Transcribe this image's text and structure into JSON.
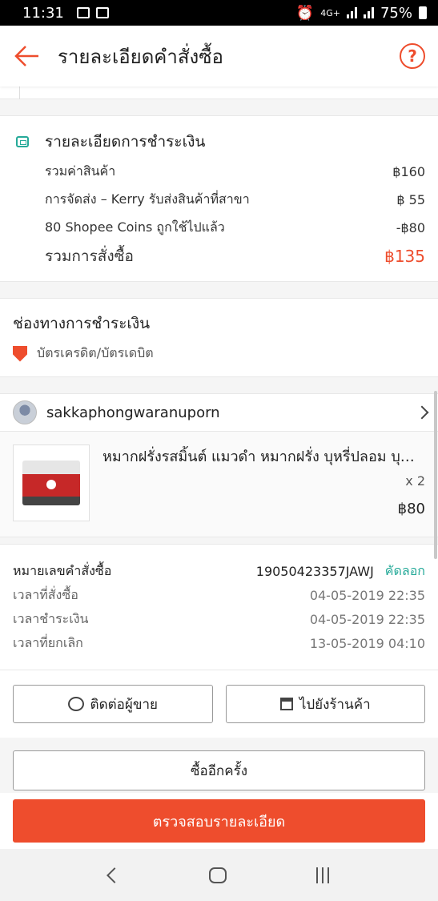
{
  "status_bar": {
    "time": "11:31",
    "network": "4G+",
    "battery": "75%"
  },
  "header": {
    "title": "รายละเอียดคำสั่งซื้อ",
    "help_label": "?"
  },
  "payment_details": {
    "title": "รายละเอียดการชำระเงิน",
    "rows": [
      {
        "label": "รวมค่าสินค้า",
        "value": "฿160"
      },
      {
        "label": "การจัดส่ง – Kerry รับส่งสินค้าที่สาขา",
        "value": "฿ 55"
      },
      {
        "label": "80 Shopee Coins ถูกใช้ไปแล้ว",
        "value": "-฿80"
      }
    ],
    "total_label": "รวมการสั่งซื้อ",
    "total_value": "฿135",
    "accent_color": "#ee4d2d"
  },
  "payment_method": {
    "title": "ช่องทางการชำระเงิน",
    "method": "บัตรเครดิต/บัตรเดบิต"
  },
  "seller": {
    "name": "sakkaphongwaranuporn"
  },
  "product": {
    "name": "หมากฝรั่งรสมิ้นต์ แมวดำ หมากฝรั่ง บุหรี่ปลอม บุหรี่ปลอม",
    "quantity": "x 2",
    "price": "฿80"
  },
  "order_info": {
    "order_no_label": "หมายเลขคำสั่งซื้อ",
    "order_no": "19050423357JAWJ",
    "copy_label": "คัดลอก",
    "rows": [
      {
        "label": "เวลาที่สั่งซื้อ",
        "value": "04-05-2019 22:35"
      },
      {
        "label": "เวลาชำระเงิน",
        "value": "04-05-2019 22:35"
      },
      {
        "label": "เวลาที่ยกเลิก",
        "value": "13-05-2019 04:10"
      }
    ]
  },
  "actions": {
    "contact_seller": "ติดต่อผู้ขาย",
    "go_to_shop": "ไปยังร้านค้า",
    "buy_again": "ซื้ออีกครั้ง",
    "check_details": "ตรวจสอบรายละเอียด"
  }
}
